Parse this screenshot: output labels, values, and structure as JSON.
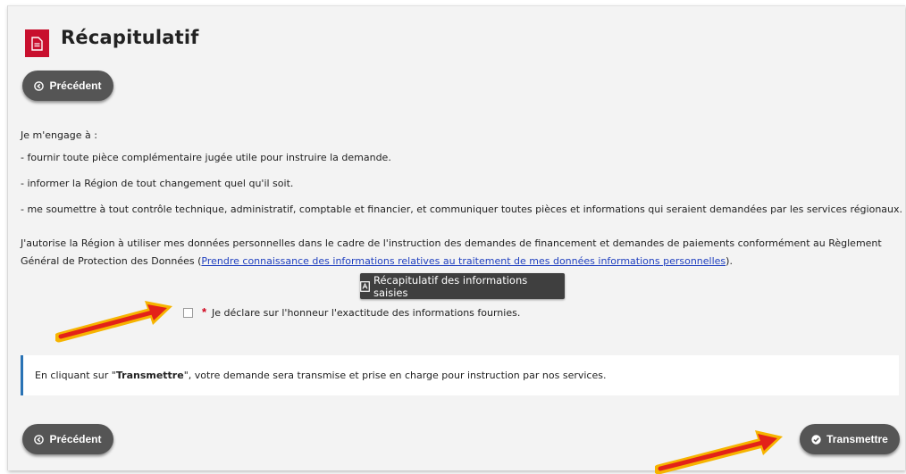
{
  "header": {
    "title": "Récapitulatif",
    "title_icon": "document-icon",
    "accent_color": "#c8102e"
  },
  "nav": {
    "previous_label": "Précédent",
    "submit_label": "Transmettre"
  },
  "commitments": {
    "intro": "Je m'engage à :",
    "items": [
      "- fournir toute pièce complémentaire jugée utile pour instruire la demande.",
      "-  informer la Région de tout changement quel qu'il soit.",
      "- me soumettre à tout contrôle technique, administratif, comptable et financier, et communiquer toutes pièces et informations qui seraient demandées par les services régionaux."
    ]
  },
  "rgpd": {
    "text_before": "J'autorise la Région à utiliser mes données personnelles dans le cadre de l'instruction des demandes de financement et demandes de paiements conformément au Règlement Général de Protection des Données (",
    "link_text": "Prendre connaissance des informations relatives au traitement de mes données informations personnelles",
    "text_after": ")."
  },
  "summary_button": {
    "label": "Récapitulatif des informations saisies",
    "icon": "pdf-icon"
  },
  "declaration": {
    "required_mark": "*",
    "label": "Je déclare sur l'honneur l'exactitude des informations fournies.",
    "checked": false
  },
  "info_box": {
    "text_before": "En cliquant sur \"",
    "bold": "Transmettre",
    "text_after": "\", votre demande sera transmise et prise en charge pour instruction par nos services."
  }
}
